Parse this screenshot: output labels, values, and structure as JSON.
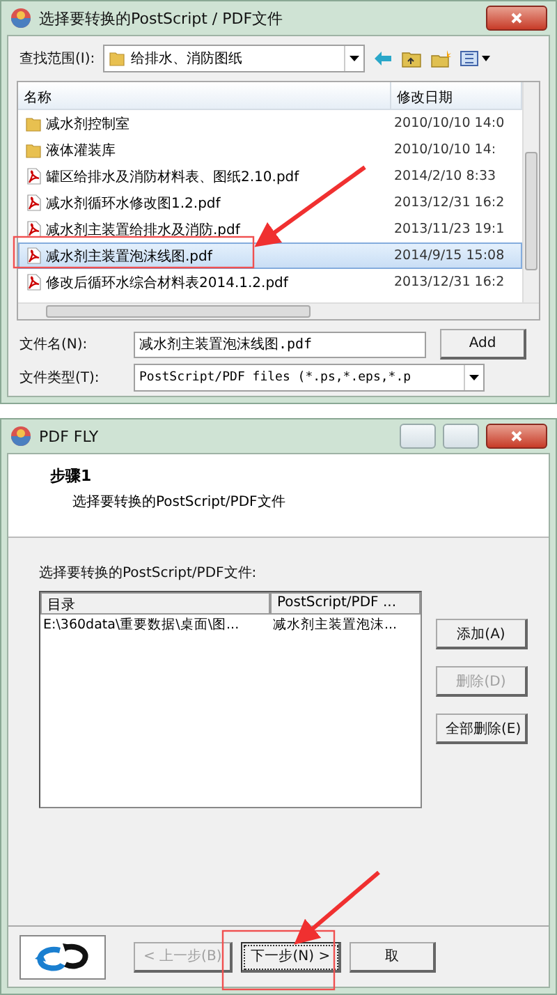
{
  "open_dialog": {
    "title": "选择要转换的PostScript / PDF文件",
    "look_in": {
      "label": "查找范围(I):",
      "value": "给排水、消防图纸"
    },
    "columns": [
      "名称",
      "修改日期"
    ],
    "files": [
      {
        "kind": "folder",
        "name": "减水剂控制室",
        "date": "2010/10/10 14:0",
        "selected": false
      },
      {
        "kind": "folder",
        "name": "液体灌装库",
        "date": "2010/10/10 14:",
        "selected": false
      },
      {
        "kind": "pdf",
        "name": "罐区给排水及消防材料表、图纸2.10.pdf",
        "date": "2014/2/10 8:33",
        "selected": false
      },
      {
        "kind": "pdf",
        "name": "减水剂循环水修改图1.2.pdf",
        "date": "2013/12/31 16:2",
        "selected": false
      },
      {
        "kind": "pdf",
        "name": "减水剂主装置给排水及消防.pdf",
        "date": "2013/11/23 19:1",
        "selected": false
      },
      {
        "kind": "pdf",
        "name": "减水剂主装置泡沫线图.pdf",
        "date": "2014/9/15 15:08",
        "selected": true
      },
      {
        "kind": "pdf",
        "name": "修改后循环水综合材料表2014.1.2.pdf",
        "date": "2013/12/31 16:2",
        "selected": false
      }
    ],
    "file_name": {
      "label": "文件名(N):",
      "value": "减水剂主装置泡沫线图.pdf"
    },
    "file_type": {
      "label": "文件类型(T):",
      "value": "PostScript/PDF files (*.ps,*.eps,*.p"
    },
    "add_button": "Add"
  },
  "wizard": {
    "title": "PDF FLY",
    "step_title": "步骤1",
    "step_subtitle": "选择要转换的PostScript/PDF文件",
    "list_label": "选择要转换的PostScript/PDF文件:",
    "columns": [
      "目录",
      "PostScript/PDF ..."
    ],
    "rows": [
      {
        "directory": "E:\\360data\\重要数据\\桌面\\图...",
        "file": "减水剂主装置泡沫..."
      }
    ],
    "side_buttons": [
      {
        "label": "添加(A)",
        "disabled": false
      },
      {
        "label": "删除(D)",
        "disabled": true
      },
      {
        "label": "全部删除(E)",
        "disabled": false
      }
    ],
    "nav_buttons": [
      {
        "label": "< 上一步(B)",
        "disabled": true,
        "focused": false
      },
      {
        "label": "下一步(N) >",
        "disabled": false,
        "focused": true
      },
      {
        "label": "取",
        "disabled": false,
        "focused": false
      }
    ]
  }
}
